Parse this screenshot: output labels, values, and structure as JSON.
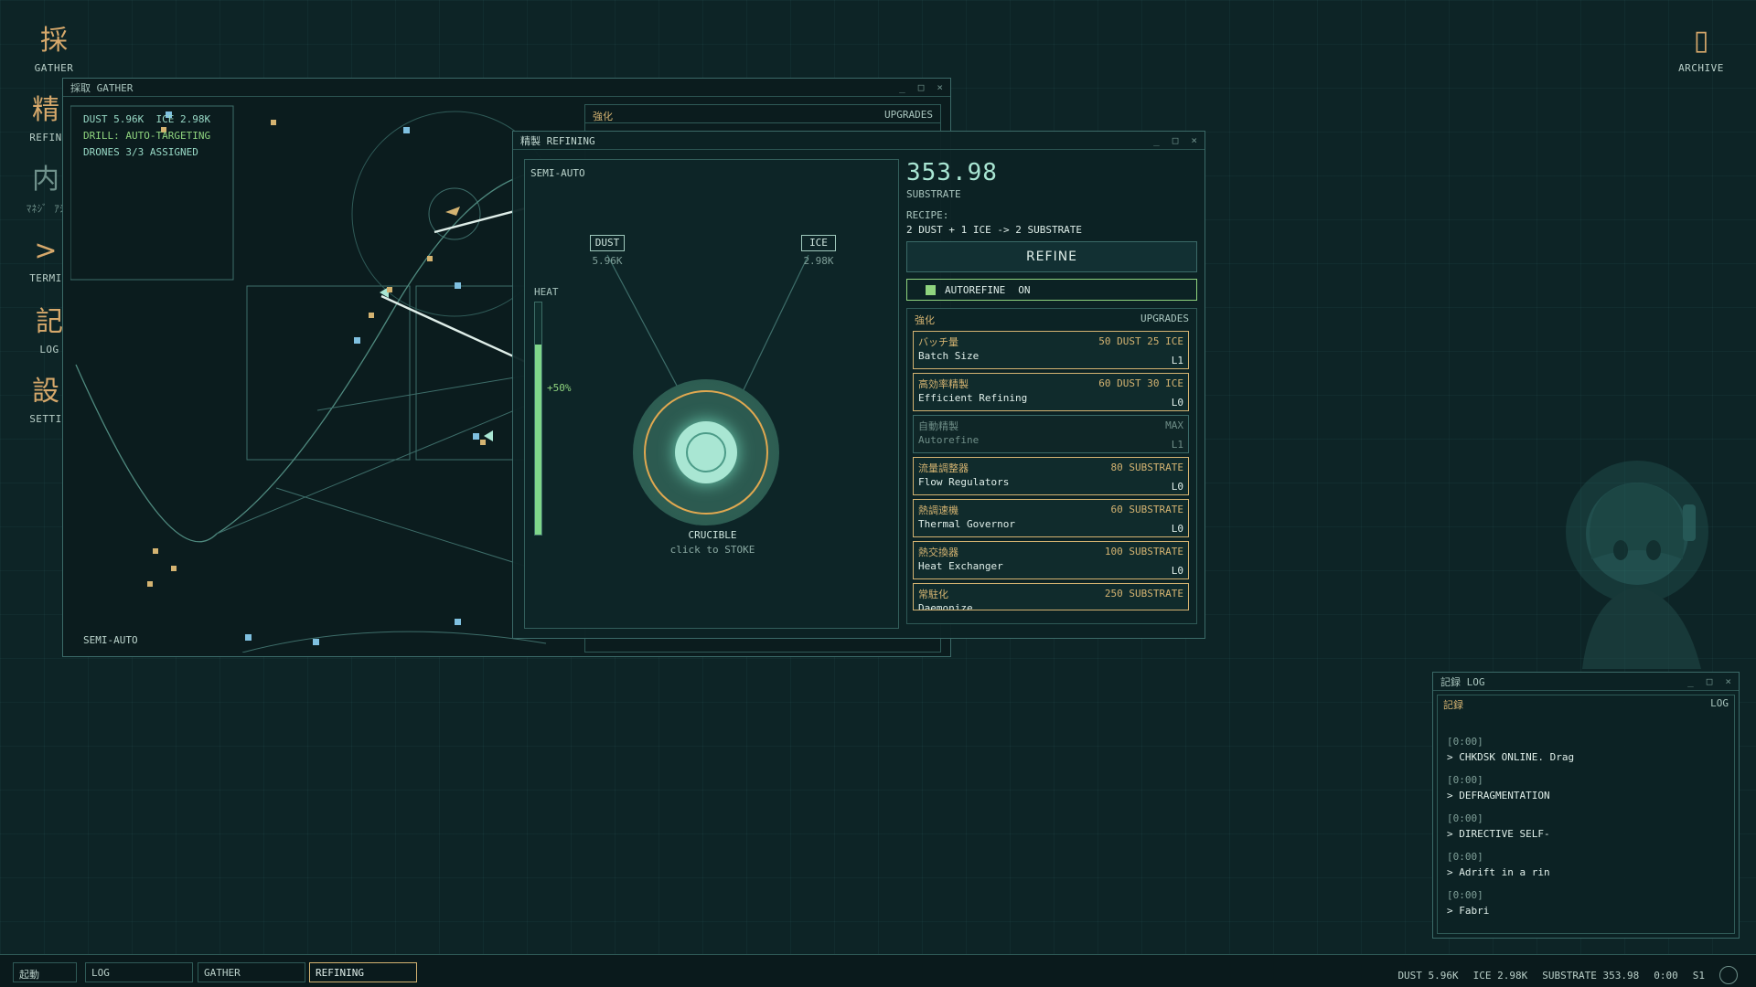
{
  "desktop": {
    "icons": [
      {
        "glyph": "採",
        "label": "GATHER"
      },
      {
        "glyph": "精",
        "label": "REFIN"
      },
      {
        "glyph": "内",
        "label": "ﾏﾈｼﾞ ｱｼ"
      },
      {
        "glyph": ">",
        "label": "TERMI"
      },
      {
        "glyph": "記",
        "label": "LOG"
      },
      {
        "glyph": "設",
        "label": "SETTI"
      }
    ],
    "archive": {
      "glyph": "▯",
      "label": "ARCHIVE"
    }
  },
  "gather_window": {
    "title": "採取 GATHER",
    "status": {
      "dust": "DUST 5.96K",
      "ice": "ICE 2.98K",
      "drill": "DRILL: AUTO-TARGETING",
      "drones": "DRONES 3/3 ASSIGNED"
    },
    "mode": "SEMI-AUTO",
    "upgrades_jp": "強化",
    "upgrades_en": "UPGRADES"
  },
  "refining_window": {
    "title": "精製 REFINING",
    "mode": "SEMI-AUTO",
    "dust_label": "DUST",
    "dust_value": "5.96K",
    "ice_label": "ICE",
    "ice_value": "2.98K",
    "heat_label": "HEAT",
    "heat_pct_label": "+50%",
    "heat_level": 0.82,
    "crucible_label": "CRUCIBLE",
    "crucible_hint": "click to STOKE",
    "substrate_value": "353.98",
    "substrate_label": "SUBSTRATE",
    "recipe_label": "RECIPE:",
    "recipe_text": "2 DUST + 1 ICE -> 2 SUBSTRATE",
    "refine_button": "REFINE",
    "autorefine_label": "AUTOREFINE",
    "autorefine_state": "ON",
    "upgrades_jp": "強化",
    "upgrades_en": "UPGRADES",
    "upgrades": [
      {
        "jp": "バッチ量",
        "en": "Batch Size",
        "cost": "50 DUST 25 ICE",
        "level": "L1"
      },
      {
        "jp": "高効率精製",
        "en": "Efficient Refining",
        "cost": "60 DUST 30 ICE",
        "level": "L0"
      },
      {
        "jp": "自動精製",
        "en": "Autorefine",
        "cost": "MAX",
        "level": "L1"
      },
      {
        "jp": "流量調整器",
        "en": "Flow Regulators",
        "cost": "80 SUBSTRATE",
        "level": "L0"
      },
      {
        "jp": "熱調速機",
        "en": "Thermal Governor",
        "cost": "60 SUBSTRATE",
        "level": "L0"
      },
      {
        "jp": "熱交換器",
        "en": "Heat Exchanger",
        "cost": "100 SUBSTRATE",
        "level": "L0"
      },
      {
        "jp": "常駐化",
        "en": "Daemonize",
        "cost": "250 SUBSTRATE",
        "level": ""
      }
    ]
  },
  "log_window": {
    "title": "記録 LOG",
    "header_jp": "記録",
    "header_en": "LOG",
    "entries": [
      {
        "ts": "[0:00]",
        "msg": "> CHKDSK ONLINE. Drag"
      },
      {
        "ts": "[0:00]",
        "msg": "> DEFRAGMENTATION"
      },
      {
        "ts": "[0:00]",
        "msg": "> DIRECTIVE SELF-"
      },
      {
        "ts": "[0:00]",
        "msg": "> Adrift in a rin"
      },
      {
        "ts": "[0:00]",
        "msg": "> Fabri"
      }
    ]
  },
  "window_controls": {
    "minimize": "_",
    "maximize": "□",
    "close": "×"
  },
  "taskbar": {
    "start": "起動",
    "buttons": [
      "LOG",
      "GATHER",
      "REFINING"
    ],
    "tray": {
      "dust": "DUST 5.96K",
      "ice": "ICE 2.98K",
      "substrate": "SUBSTRATE 353.98",
      "time": "0:00",
      "slot": "S1"
    }
  },
  "colors": {
    "accent_gold": "#d4b371",
    "accent_cyan": "#a9e6d3",
    "accent_green": "#8fd47e",
    "background": "#0d2426"
  }
}
